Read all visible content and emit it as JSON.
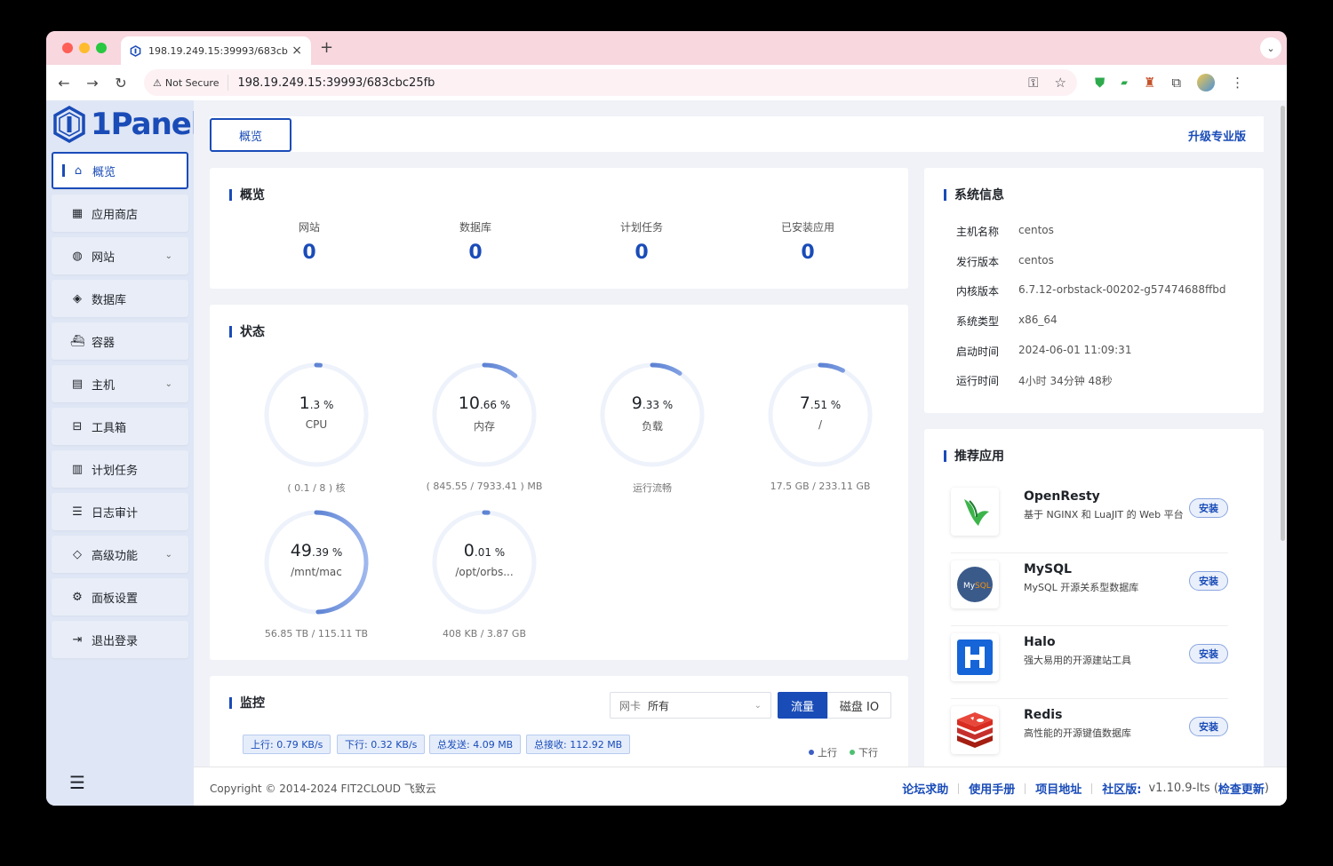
{
  "browser": {
    "tab_title": "198.19.249.15:39993/683cbc",
    "not_secure": "Not Secure",
    "url": "198.19.249.15:39993/683cbc25fb"
  },
  "brand": {
    "logo_text": "1Panel",
    "accent": "#1a4cb8"
  },
  "menu": [
    {
      "label": "概览",
      "icon": "home-icon"
    },
    {
      "label": "应用商店",
      "icon": "grid-icon"
    },
    {
      "label": "网站",
      "icon": "globe-icon"
    },
    {
      "label": "数据库",
      "icon": "layers-icon"
    },
    {
      "label": "容器",
      "icon": "docker-icon"
    },
    {
      "label": "主机",
      "icon": "server-icon"
    },
    {
      "label": "工具箱",
      "icon": "toolbox-icon"
    },
    {
      "label": "计划任务",
      "icon": "calendar-icon"
    },
    {
      "label": "日志审计",
      "icon": "log-icon"
    },
    {
      "label": "高级功能",
      "icon": "diamond-icon"
    },
    {
      "label": "面板设置",
      "icon": "gear-icon"
    },
    {
      "label": "退出登录",
      "icon": "logout-icon"
    }
  ],
  "header": {
    "tab": "概览",
    "upgrade": "升级专业版"
  },
  "overview": {
    "title": "概览",
    "stats": [
      {
        "label": "网站",
        "value": "0"
      },
      {
        "label": "数据库",
        "value": "0"
      },
      {
        "label": "计划任务",
        "value": "0"
      },
      {
        "label": "已安装应用",
        "value": "0"
      }
    ]
  },
  "status": {
    "title": "状态",
    "gauges": [
      {
        "int": "1",
        "dec": ".3",
        "percent": 1.3,
        "name": "CPU",
        "foot": "( 0.1 / 8 ) 核"
      },
      {
        "int": "10",
        "dec": ".66",
        "percent": 10.66,
        "name": "内存",
        "foot": "( 845.55 / 7933.41 ) MB"
      },
      {
        "int": "9",
        "dec": ".33",
        "percent": 9.33,
        "name": "负载",
        "foot": "运行流畅"
      },
      {
        "int": "7",
        "dec": ".51",
        "percent": 7.51,
        "name": "/",
        "foot": "17.5 GB / 233.11 GB"
      },
      {
        "int": "49",
        "dec": ".39",
        "percent": 49.39,
        "name": "/mnt/mac",
        "foot": "56.85 TB / 115.11 TB"
      },
      {
        "int": "0",
        "dec": ".01",
        "percent": 0.01,
        "name": "/opt/orbs...",
        "foot": "408 KB / 3.87 GB"
      }
    ]
  },
  "monitor": {
    "title": "监控",
    "nic_prefix": "网卡",
    "nic_value": "所有",
    "tab_traffic": "流量",
    "tab_disk": "磁盘 IO",
    "chips": [
      "上行: 0.79 KB/s",
      "下行: 0.32 KB/s",
      "总发送: 4.09 MB",
      "总接收: 112.92 MB"
    ],
    "legend_up": "上行",
    "legend_down": "下行"
  },
  "sysinfo": {
    "title": "系统信息",
    "rows": [
      {
        "k": "主机名称",
        "v": "centos"
      },
      {
        "k": "发行版本",
        "v": "centos"
      },
      {
        "k": "内核版本",
        "v": "6.7.12-orbstack-00202-g57474688ffbd"
      },
      {
        "k": "系统类型",
        "v": "x86_64"
      },
      {
        "k": "启动时间",
        "v": "2024-06-01 11:09:31"
      },
      {
        "k": "运行时间",
        "v": "4小时 34分钟 48秒"
      }
    ]
  },
  "recommended": {
    "title": "推荐应用",
    "install": "安装",
    "apps": [
      {
        "name": "OpenResty",
        "desc": "基于 NGINX 和 LuaJIT 的 Web 平台",
        "icon": "openresty-icon"
      },
      {
        "name": "MySQL",
        "desc": "MySQL 开源关系型数据库",
        "icon": "mysql-icon"
      },
      {
        "name": "Halo",
        "desc": "强大易用的开源建站工具",
        "icon": "halo-icon"
      },
      {
        "name": "Redis",
        "desc": "高性能的开源键值数据库",
        "icon": "redis-icon"
      }
    ]
  },
  "footer": {
    "copyright": "Copyright © 2014-2024 FIT2CLOUD 飞致云",
    "links": [
      "论坛求助",
      "使用手册",
      "项目地址"
    ],
    "edition": "社区版:",
    "version": "v1.10.9-lts",
    "check_update": "检查更新"
  }
}
